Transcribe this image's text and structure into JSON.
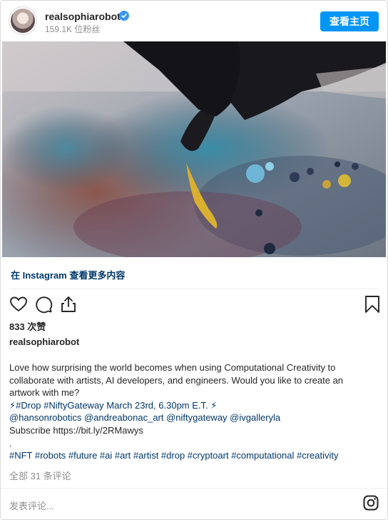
{
  "header": {
    "username": "realsophiarobot",
    "followers": "159.1K 位粉丝",
    "profile_button": "查看主页"
  },
  "view_more": "在 Instagram 查看更多内容",
  "icons": [
    "heart-icon",
    "comment-icon",
    "share-icon",
    "bookmark-icon",
    "verified-badge-icon",
    "instagram-logo-icon"
  ],
  "likes": "833 次赞",
  "author": "realsophiarobot",
  "caption": {
    "line1": "Love how surprising the world becomes when using Computational Creativity to",
    "line2": "collaborate with artists, AI developers, and engineers. Would you like to create an",
    "line3": "artwork with me?",
    "line4": "⚡#Drop #NiftyGateway March 23rd, 6.30pm E.T. ⚡",
    "line5": "@hansonrobotics @andreabonac_art @niftygateway @ivgalleryla",
    "line6": "Subscribe https://bit.ly/2RMawys",
    "line7": ".",
    "line8": "#NFT #robots #future #ai #art #artist #drop #cryptoart #computational #creativity"
  },
  "comments_link": "全部 31 条评论",
  "comment_placeholder": "发表评论...",
  "colors": {
    "button_blue": "#0095f6",
    "link_dark_blue": "#00376b",
    "muted_gray": "#8e8e8e",
    "border": "#dbdbdb"
  }
}
